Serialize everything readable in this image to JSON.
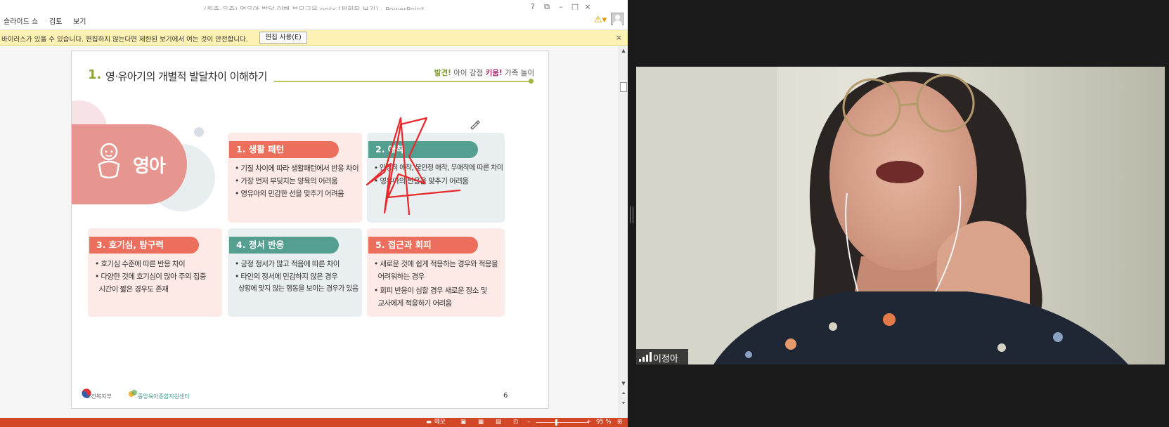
{
  "window": {
    "title": "(최종-유준) 영유아 발달 이해 부모교육.pptx [제한된 보기] - PowerPoint",
    "controls": [
      "?",
      "⧉",
      "–",
      "□",
      "×"
    ]
  },
  "ribbon": {
    "tabs": [
      "슬라이드 쇼",
      "검토",
      "보기"
    ]
  },
  "infobar": {
    "message": "바이러스가 있을 수 있습니다. 편집하지 않는다면 제한된 보기에서 여는 것이 안전합니다.",
    "button_label": "편집 사용(E)",
    "close": "×"
  },
  "slide": {
    "number": "1.",
    "heading": "영·유아기의 개별적 발달차이 이해하기",
    "tagline": {
      "part1": "발견!",
      "part2": " 아이 강점 ",
      "part3": "키움!",
      "part4": " 가족 놀이"
    },
    "age_label": "영아",
    "cards": [
      {
        "title": "1. 생활 패턴",
        "bullets": [
          "기질 차이에 따라 생활패턴에서 반응 차이",
          "가장 먼저 부딪치는 양육의 어려움",
          "영유아의 민감한 선을 맞추기 어려움"
        ]
      },
      {
        "title": "2. 애착",
        "bullets": [
          "안정적 애착, 불안정 애착, 무애착에 따른 차이",
          "영유아의 반응을 맞추기 어려움"
        ]
      },
      {
        "title": "3. 호기심, 탐구력",
        "bullets": [
          "호기심 수준에 따른 반응 차이",
          "다양한 것에 호기심이 많아 주의 집중",
          "시간이 짧은 경우도 존재"
        ]
      },
      {
        "title": "4. 정서 반응",
        "bullets": [
          "긍정 정서가 많고 적음에 따른 차이",
          "타인의 정서에 민감하지 않은 경우",
          "상황에 맞지 않는 행동을 보이는 경우가 있음"
        ]
      },
      {
        "title": "5. 접근과 회피",
        "bullets": [
          "새로운 것에 쉽게 적응하는 경우와 적응을",
          "어려워하는 경우",
          "회피 반응이 심할 경우 새로운 장소 및",
          "교사에게 적응하기 어려움"
        ]
      }
    ],
    "footer": {
      "ministry": "보건복지부",
      "center": "중앙육아종합지원센터",
      "page": "6"
    }
  },
  "statusbar": {
    "notes": "메모",
    "zoom": "95 %"
  },
  "video": {
    "participant_name": "이정아"
  },
  "colors": {
    "accent_coral": "#ec6e5c",
    "accent_teal": "#549f90",
    "status_bar": "#d24726",
    "infobar": "#fdf1b3",
    "annotation_red": "#e8282a"
  }
}
